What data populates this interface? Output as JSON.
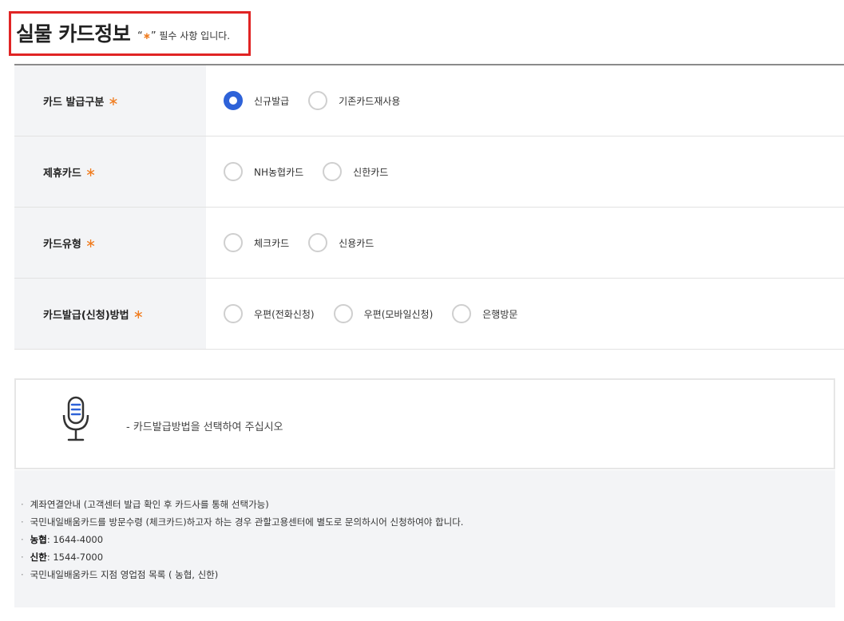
{
  "header": {
    "title": "실물 카드정보",
    "note_open_quote": "“",
    "note_star": "∗",
    "note_close_quote": "”",
    "note_text": "필수 사항 입니다."
  },
  "form": {
    "required_mark": "∗",
    "rows": [
      {
        "label": "카드 발급구분",
        "options": [
          "신규발급",
          "기존카드재사용"
        ],
        "selected": 0
      },
      {
        "label": "제휴카드",
        "options": [
          "NH농협카드",
          "신한카드"
        ],
        "selected": null
      },
      {
        "label": "카드유형",
        "options": [
          "체크카드",
          "신용카드"
        ],
        "selected": null
      },
      {
        "label": "카드발급(신청)방법",
        "options": [
          "우편(전화신청)",
          "우편(모바일신청)",
          "은행방문"
        ],
        "selected": null
      }
    ]
  },
  "notice": {
    "icon": "microphone-icon",
    "text": "- 카드발급방법을 선택하여 주십시오"
  },
  "info": {
    "bullet": "·",
    "items": [
      {
        "bold": "",
        "text": "계좌연결안내 (고객센터 발급 확인 후 카드사를 통해 선택가능)"
      },
      {
        "bold": "",
        "text": "국민내일배움카드를 방문수령 (체크카드)하고자 하는 경우 관할고용센터에 별도로 문의하시어 신청하여야 합니다."
      },
      {
        "bold": "농협",
        "text": ": 1644-4000"
      },
      {
        "bold": "신한",
        "text": ": 1544-7000"
      },
      {
        "bold": "",
        "text": "국민내일배움카드 지점 영업점 목록 ( 농협, 신한)"
      }
    ]
  },
  "colors": {
    "accent_blue": "#2e62d8",
    "required_orange": "#f07c1f",
    "highlight_red": "#e02424"
  }
}
